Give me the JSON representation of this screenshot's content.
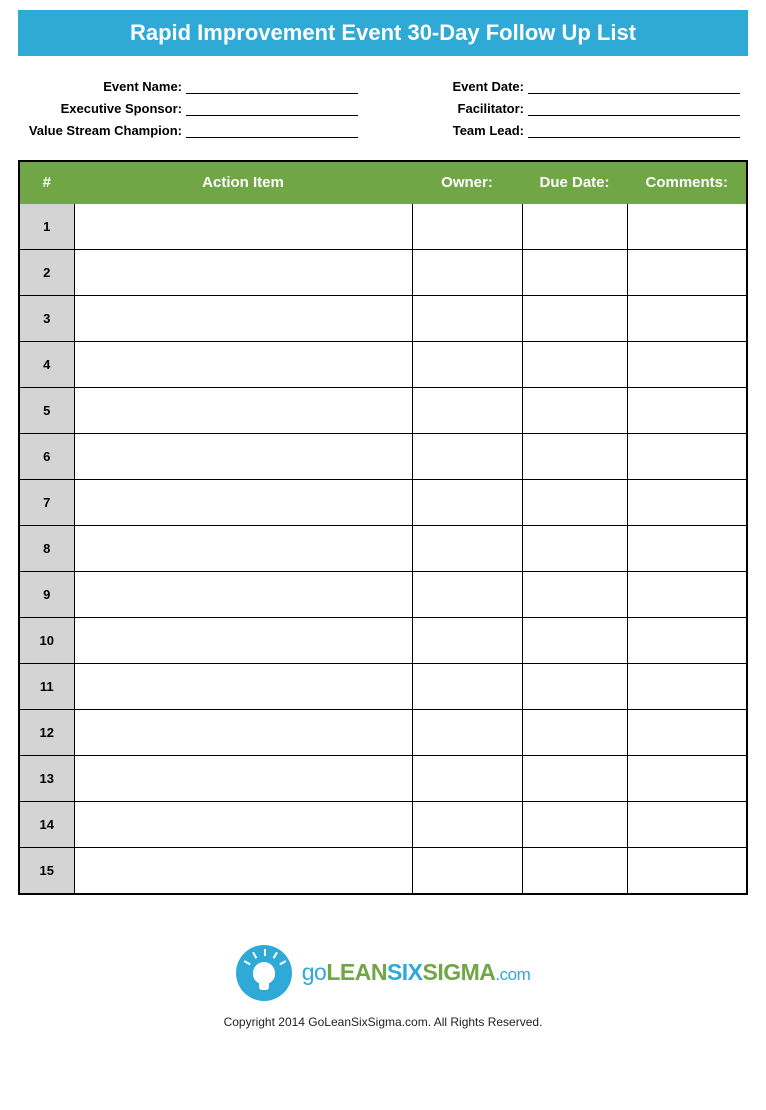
{
  "title": "Rapid Improvement Event 30-Day Follow Up List",
  "meta": {
    "left": [
      {
        "label": "Event Name:",
        "value": ""
      },
      {
        "label": "Executive Sponsor:",
        "value": ""
      },
      {
        "label": "Value Stream Champion:",
        "value": ""
      }
    ],
    "right": [
      {
        "label": "Event Date:",
        "value": ""
      },
      {
        "label": "Facilitator:",
        "value": ""
      },
      {
        "label": "Team Lead:",
        "value": ""
      }
    ]
  },
  "table": {
    "headers": {
      "num": "#",
      "action": "Action Item",
      "owner": "Owner:",
      "due": "Due Date:",
      "comments": "Comments:"
    },
    "rows": [
      {
        "num": "1",
        "action": "",
        "owner": "",
        "due": "",
        "comments": ""
      },
      {
        "num": "2",
        "action": "",
        "owner": "",
        "due": "",
        "comments": ""
      },
      {
        "num": "3",
        "action": "",
        "owner": "",
        "due": "",
        "comments": ""
      },
      {
        "num": "4",
        "action": "",
        "owner": "",
        "due": "",
        "comments": ""
      },
      {
        "num": "5",
        "action": "",
        "owner": "",
        "due": "",
        "comments": ""
      },
      {
        "num": "6",
        "action": "",
        "owner": "",
        "due": "",
        "comments": ""
      },
      {
        "num": "7",
        "action": "",
        "owner": "",
        "due": "",
        "comments": ""
      },
      {
        "num": "8",
        "action": "",
        "owner": "",
        "due": "",
        "comments": ""
      },
      {
        "num": "9",
        "action": "",
        "owner": "",
        "due": "",
        "comments": ""
      },
      {
        "num": "10",
        "action": "",
        "owner": "",
        "due": "",
        "comments": ""
      },
      {
        "num": "11",
        "action": "",
        "owner": "",
        "due": "",
        "comments": ""
      },
      {
        "num": "12",
        "action": "",
        "owner": "",
        "due": "",
        "comments": ""
      },
      {
        "num": "13",
        "action": "",
        "owner": "",
        "due": "",
        "comments": ""
      },
      {
        "num": "14",
        "action": "",
        "owner": "",
        "due": "",
        "comments": ""
      },
      {
        "num": "15",
        "action": "",
        "owner": "",
        "due": "",
        "comments": ""
      }
    ]
  },
  "logo": {
    "go": "go",
    "lean": "LEAN",
    "six": "SIX",
    "sigma": "SIGMA",
    "com": ".com"
  },
  "copyright": "Copyright 2014 GoLeanSixSigma.com. All Rights Reserved."
}
